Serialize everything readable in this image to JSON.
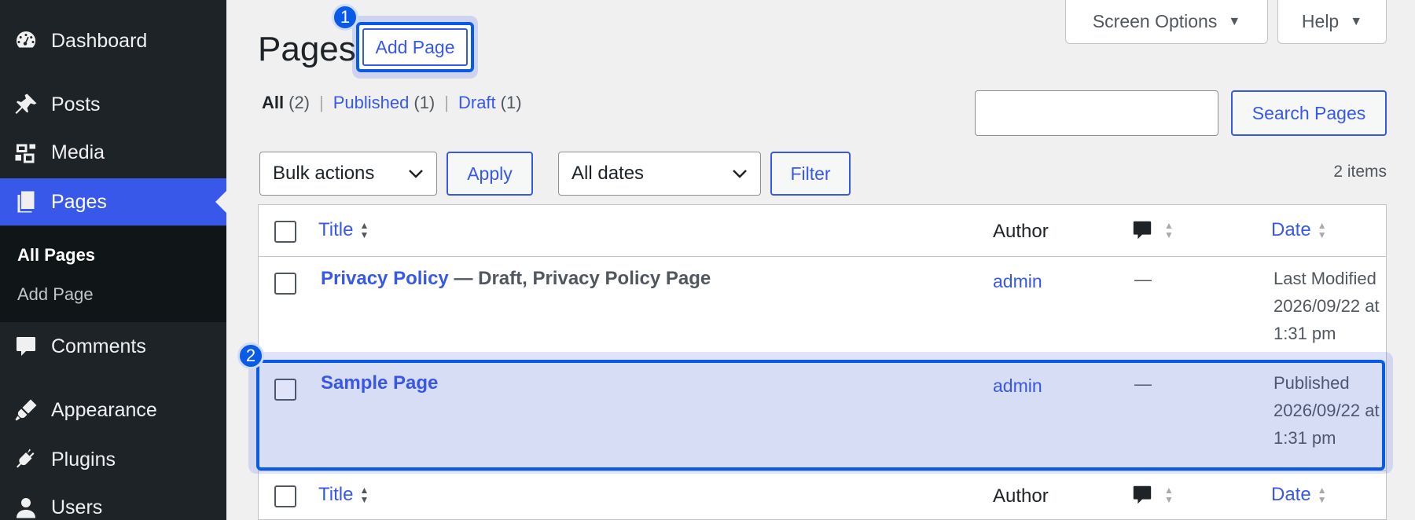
{
  "sidebar": {
    "items": [
      {
        "label": "Dashboard",
        "icon": "dashboard-icon"
      },
      {
        "label": "Posts",
        "icon": "pin-icon"
      },
      {
        "label": "Media",
        "icon": "media-icon"
      },
      {
        "label": "Pages",
        "icon": "pages-icon"
      },
      {
        "label": "Comments",
        "icon": "comment-icon"
      },
      {
        "label": "Appearance",
        "icon": "brush-icon"
      },
      {
        "label": "Plugins",
        "icon": "plug-icon"
      },
      {
        "label": "Users",
        "icon": "user-icon"
      }
    ],
    "submenu": [
      "All Pages",
      "Add Page"
    ]
  },
  "header": {
    "title": "Pages",
    "add_button": "Add Page",
    "screen_options": "Screen Options",
    "help": "Help"
  },
  "badges": [
    "1",
    "2"
  ],
  "views": {
    "all": "All",
    "all_count": "(2)",
    "published": "Published",
    "published_count": "(1)",
    "draft": "Draft",
    "draft_count": "(1)",
    "sep": "|"
  },
  "search": {
    "button": "Search Pages",
    "value": ""
  },
  "filters": {
    "bulk": "Bulk actions",
    "apply": "Apply",
    "dates": "All dates",
    "filter": "Filter",
    "items": "2 items"
  },
  "table": {
    "headers": {
      "title": "Title",
      "author": "Author",
      "date": "Date"
    },
    "rows": [
      {
        "title": "Privacy Policy",
        "state": " — Draft, Privacy Policy Page",
        "author": "admin",
        "comments": "—",
        "date_status": "Last Modified",
        "date_value": "2026/09/22 at",
        "date_time": "1:31 pm"
      },
      {
        "title": "Sample Page",
        "state": "",
        "author": "admin",
        "comments": "—",
        "date_status": "Published",
        "date_value": "2026/09/22 at",
        "date_time": "1:31 pm"
      }
    ]
  },
  "colors": {
    "accent": "#3858e9",
    "sidebar": "#1d2327",
    "highlight": "#0a5ae8"
  }
}
